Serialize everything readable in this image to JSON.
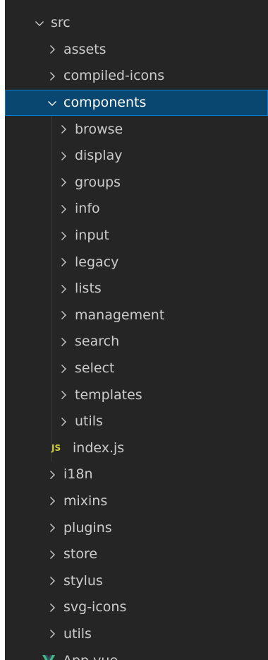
{
  "explorer": {
    "root": {
      "label": "src",
      "expanded": true
    },
    "src_children_before": [
      {
        "label": "assets"
      },
      {
        "label": "compiled-icons"
      }
    ],
    "components": {
      "label": "components",
      "expanded": true,
      "selected": true
    },
    "components_children": [
      {
        "label": "browse"
      },
      {
        "label": "display"
      },
      {
        "label": "groups"
      },
      {
        "label": "info"
      },
      {
        "label": "input"
      },
      {
        "label": "legacy"
      },
      {
        "label": "lists"
      },
      {
        "label": "management"
      },
      {
        "label": "search"
      },
      {
        "label": "select"
      },
      {
        "label": "templates"
      },
      {
        "label": "utils"
      }
    ],
    "components_file": {
      "label": "index.js",
      "badge": "JS",
      "badge_color": "#cbcb41"
    },
    "src_children_after": [
      {
        "label": "i18n"
      },
      {
        "label": "mixins"
      },
      {
        "label": "plugins"
      },
      {
        "label": "store"
      },
      {
        "label": "stylus"
      },
      {
        "label": "svg-icons"
      },
      {
        "label": "utils"
      }
    ],
    "src_file": {
      "label": "App.vue",
      "icon": "vue-icon",
      "icon_color": "#41b883"
    }
  },
  "colors": {
    "background": "#252526",
    "selected_background": "#094771",
    "selected_border": "#007fd4",
    "text": "#cccccc"
  }
}
